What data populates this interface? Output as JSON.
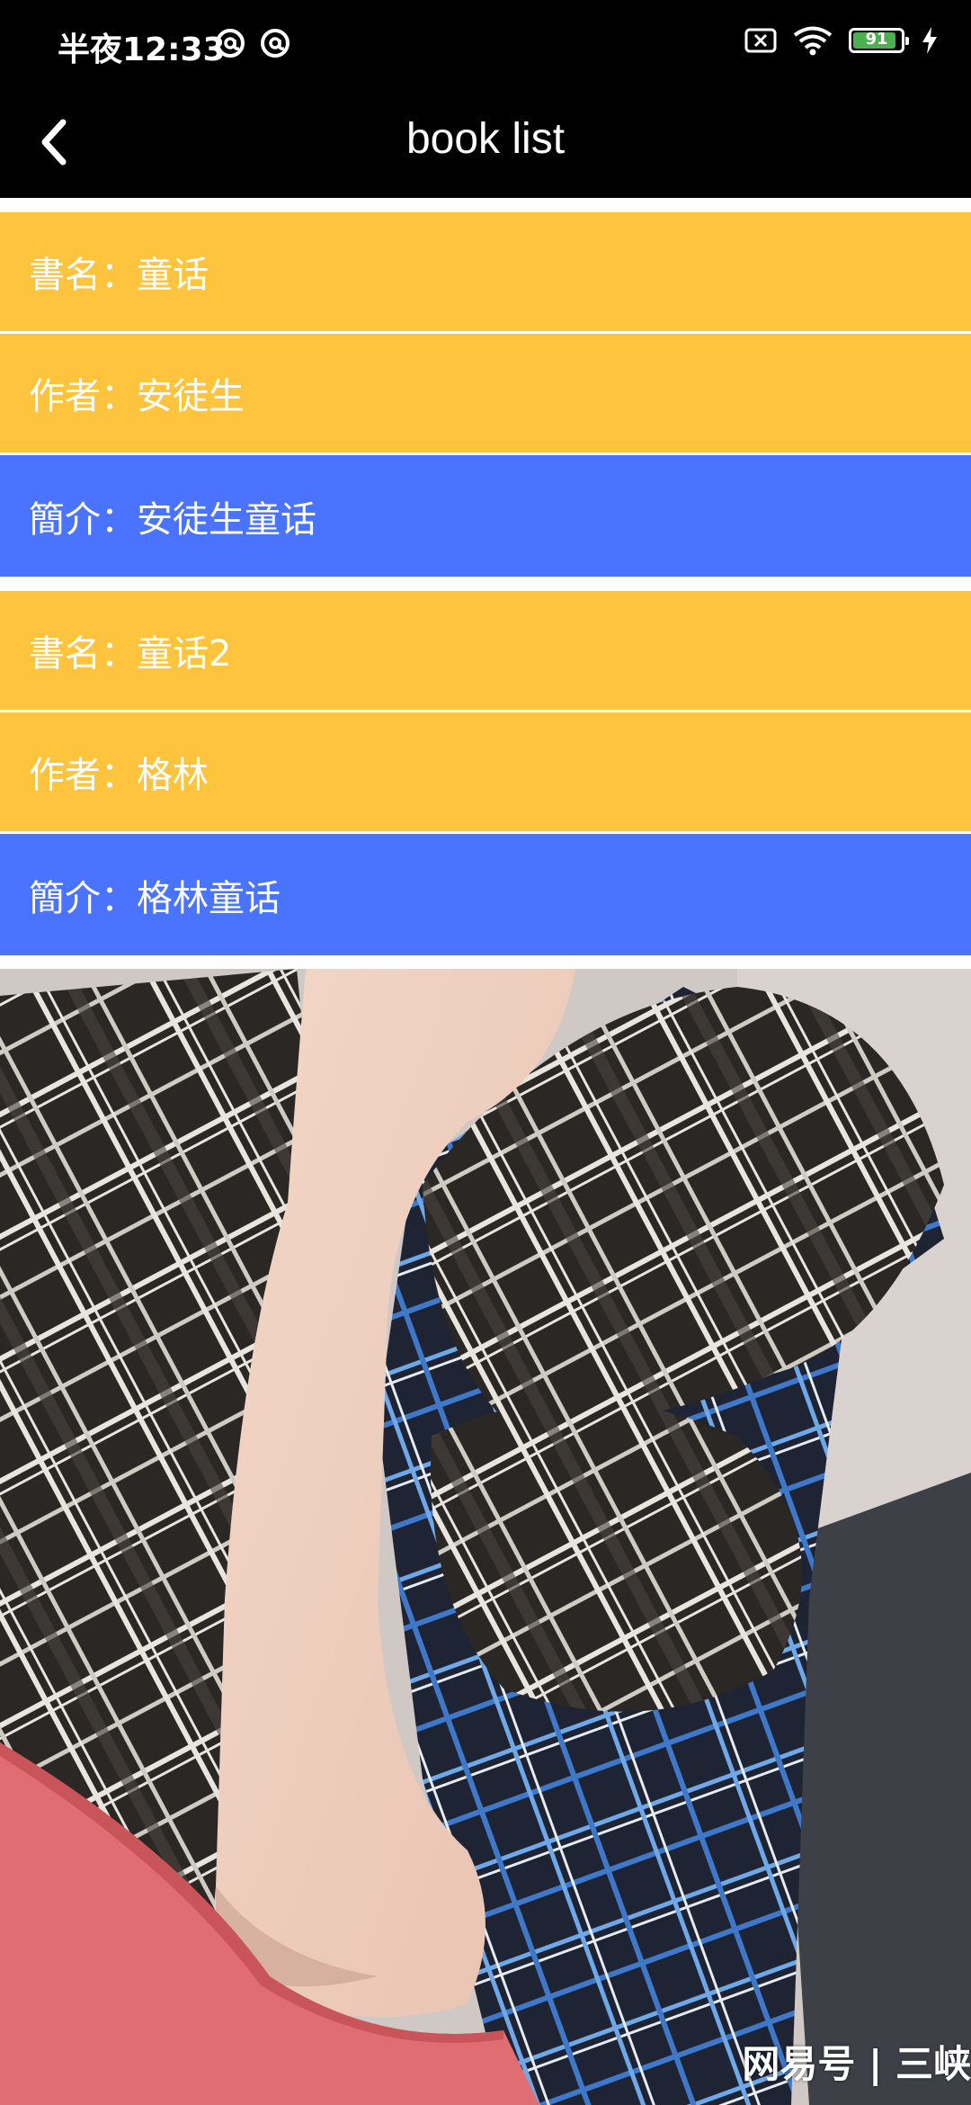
{
  "status_bar": {
    "time": "半夜12:33",
    "battery_level": "91",
    "battery_fraction": 0.91,
    "icons": [
      "at-sign-icon",
      "at-sign-icon",
      "no-sim-icon",
      "wifi-icon",
      "battery-icon",
      "charging-bolt-icon"
    ]
  },
  "app_bar": {
    "title": "book list",
    "back_icon": "chevron-left-icon"
  },
  "books": [
    {
      "title_label": "書名：",
      "title": "童话",
      "author_label": "作者：",
      "author": "安徒生",
      "intro_label": "簡介：",
      "intro": "安徒生童话"
    },
    {
      "title_label": "書名：",
      "title": "童话2",
      "author_label": "作者：",
      "author": "格林",
      "intro_label": "簡介：",
      "intro": "格林童话"
    }
  ],
  "photo": {
    "watermark": "网易号 | 三峡"
  },
  "colors": {
    "status_bar_bg": "#000000",
    "row_yellow": "#ffc43d",
    "row_blue": "#4a74ff",
    "text_white": "#ffffff",
    "battery_green": "#4caf50"
  }
}
